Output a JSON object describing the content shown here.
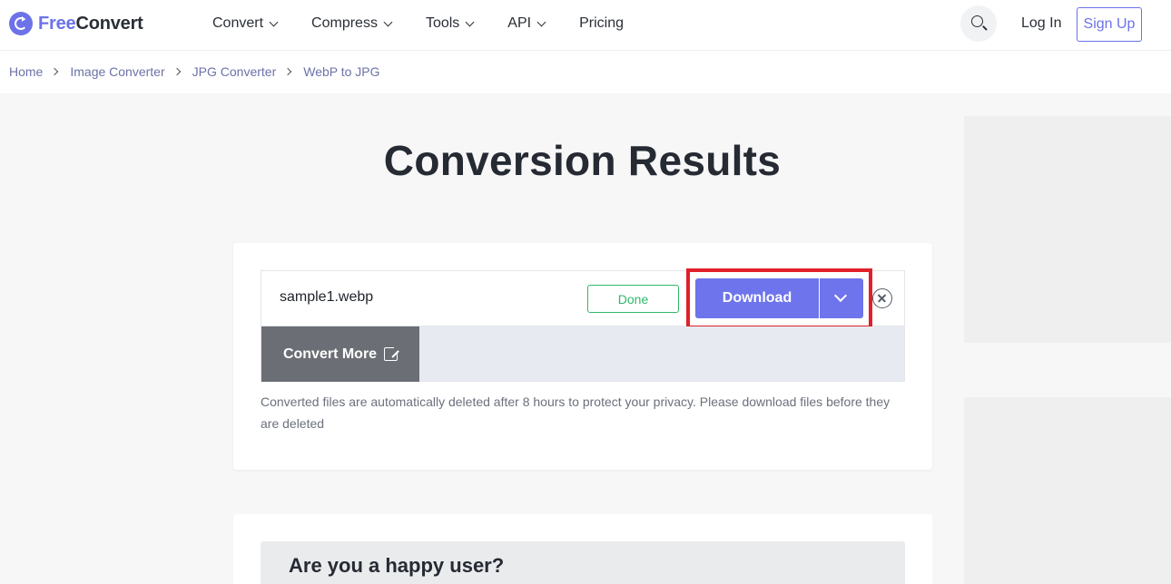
{
  "header": {
    "logo": {
      "part1": "Free",
      "part2": "Convert"
    },
    "nav": [
      {
        "label": "Convert",
        "has_dropdown": true
      },
      {
        "label": "Compress",
        "has_dropdown": true
      },
      {
        "label": "Tools",
        "has_dropdown": true
      },
      {
        "label": "API",
        "has_dropdown": true
      },
      {
        "label": "Pricing",
        "has_dropdown": false
      }
    ],
    "search_icon": "search-icon",
    "login_label": "Log In",
    "signup_label": "Sign Up"
  },
  "breadcrumb": [
    "Home",
    "Image Converter",
    "JPG Converter",
    "WebP to JPG"
  ],
  "page": {
    "title": "Conversion Results"
  },
  "result": {
    "file_name": "sample1.webp",
    "status": "Done",
    "download_label": "Download",
    "convert_more_label": "Convert More",
    "privacy_note": "Converted files are automatically deleted after 8 hours to protect your privacy. Please download files before they are deleted"
  },
  "feedback": {
    "title": "Are you a happy user?"
  },
  "colors": {
    "brand": "#6c72e8",
    "download": "#6e74eb",
    "done": "#2fb86a",
    "highlight": "#e0202a",
    "convert_more_bg": "#6b6e75"
  }
}
